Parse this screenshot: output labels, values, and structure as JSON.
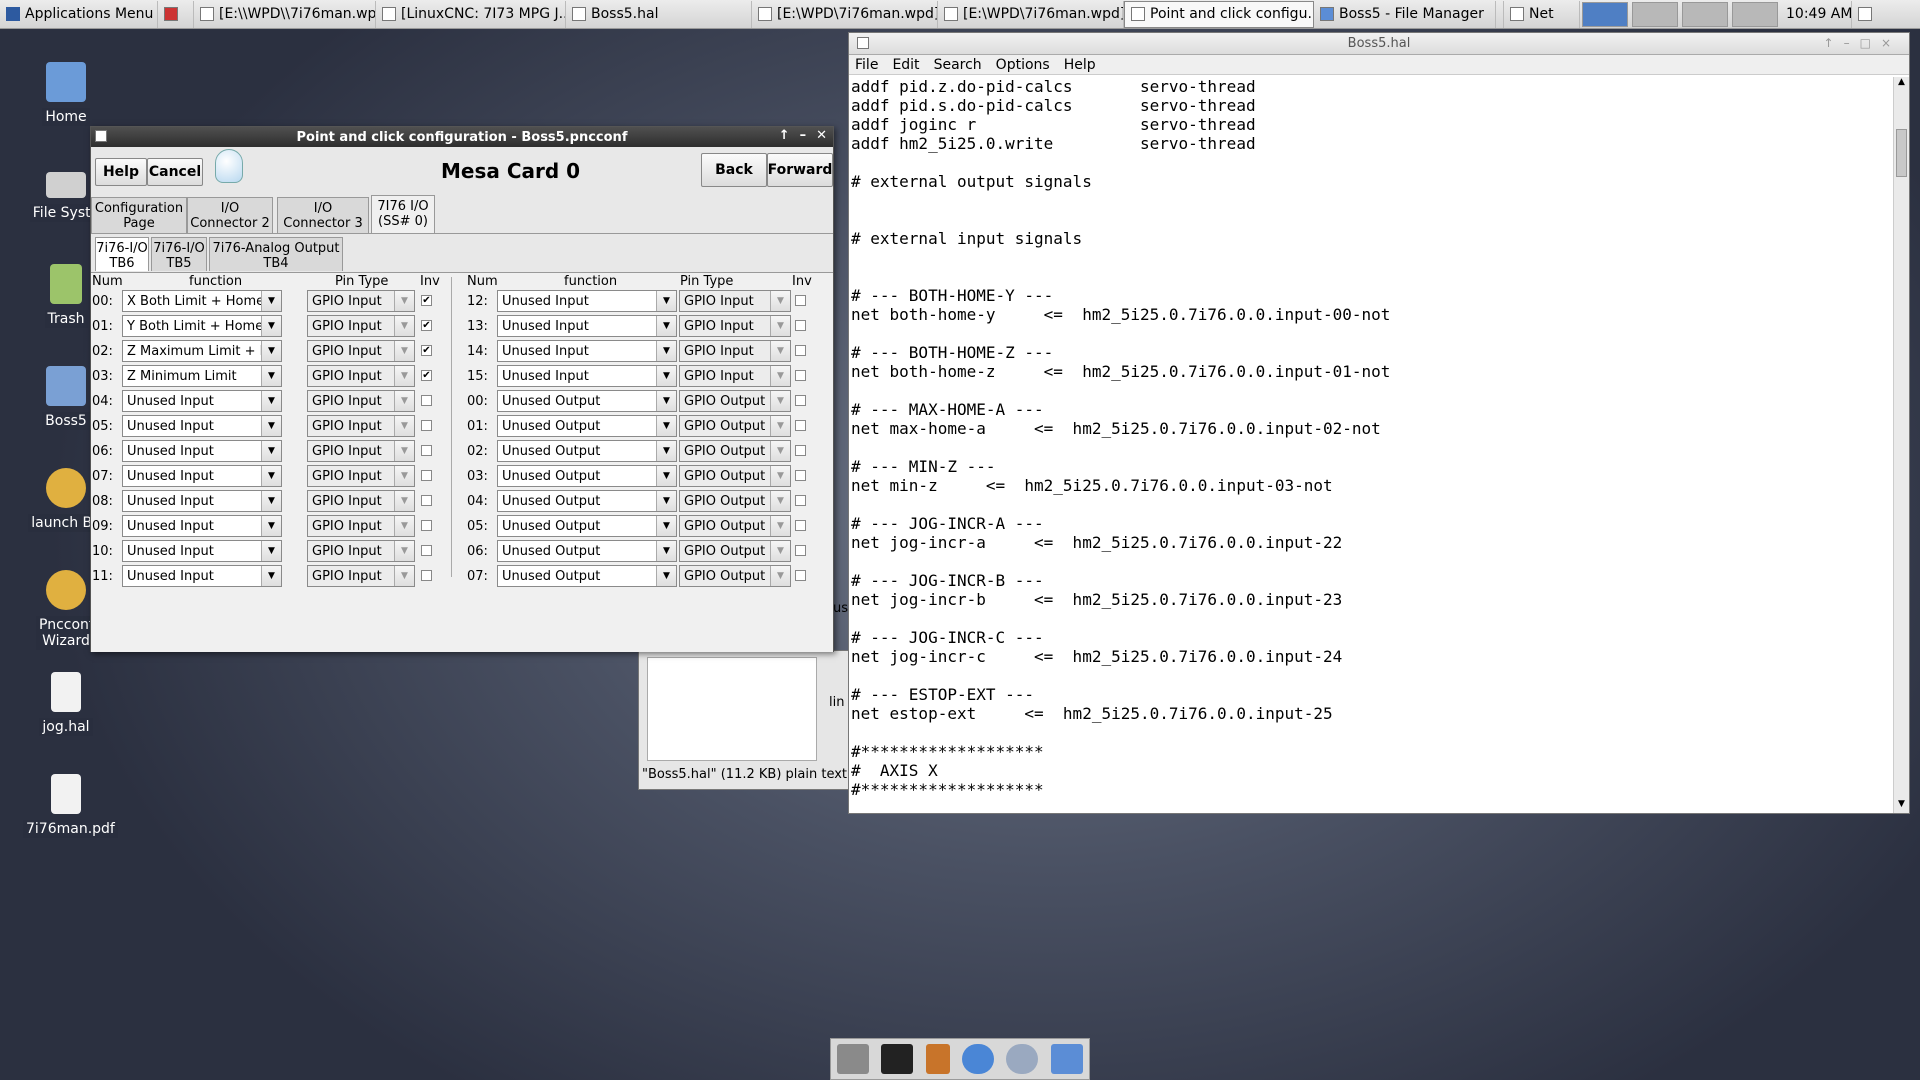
{
  "panel": {
    "apps_menu": "Applications Menu",
    "tasks": [
      {
        "label": "[E:\\\\WPD\\\\7i76man.wp..."
      },
      {
        "label": "[LinuxCNC: 7I73 MPG J..."
      },
      {
        "label": "Boss5.hal"
      },
      {
        "label": "[E:\\WPD\\7i76man.wpd]"
      },
      {
        "label": "[E:\\WPD\\7i76man.wpd]"
      },
      {
        "label": "Point and click configu..."
      },
      {
        "label": "Boss5 - File Manager"
      }
    ],
    "net": "Net",
    "clock": "10:49 AM"
  },
  "desktop": {
    "icons": [
      {
        "label": "Home"
      },
      {
        "label": "File Syste"
      },
      {
        "label": "Trash"
      },
      {
        "label": "Boss5"
      },
      {
        "label": "launch Bo"
      },
      {
        "label": "Pncconf Wizard"
      },
      {
        "label": "jog.hal"
      },
      {
        "label": "7i76man.pdf"
      }
    ]
  },
  "pncconf": {
    "title": "Point and click configuration - Boss5.pncconf",
    "help": "Help",
    "cancel": "Cancel",
    "back": "Back",
    "forward": "Forward",
    "heading": "Mesa Card 0",
    "tabs": [
      "Configuration\nPage",
      "I/O\nConnector 2",
      "I/O\nConnector 3",
      "7I76 I/O\n(SS# 0)"
    ],
    "subtabs": [
      "7i76-I/O\nTB6",
      "7i76-I/O\nTB5",
      "7i76-Analog Output\nTB4"
    ],
    "headers": {
      "num": "Num",
      "function": "function",
      "pintype": "Pin Type",
      "inv": "Inv"
    },
    "left_rows": [
      {
        "num": "00:",
        "fn": "X Both Limit + Home",
        "pt": "GPIO Input",
        "inv": true
      },
      {
        "num": "01:",
        "fn": "Y Both Limit + Home",
        "pt": "GPIO Input",
        "inv": true
      },
      {
        "num": "02:",
        "fn": "Z Maximum Limit + Ho",
        "pt": "GPIO Input",
        "inv": true
      },
      {
        "num": "03:",
        "fn": "Z Minimum Limit",
        "pt": "GPIO Input",
        "inv": true
      },
      {
        "num": "04:",
        "fn": "Unused Input",
        "pt": "GPIO Input",
        "inv": false
      },
      {
        "num": "05:",
        "fn": "Unused Input",
        "pt": "GPIO Input",
        "inv": false
      },
      {
        "num": "06:",
        "fn": "Unused Input",
        "pt": "GPIO Input",
        "inv": false
      },
      {
        "num": "07:",
        "fn": "Unused Input",
        "pt": "GPIO Input",
        "inv": false
      },
      {
        "num": "08:",
        "fn": "Unused Input",
        "pt": "GPIO Input",
        "inv": false
      },
      {
        "num": "09:",
        "fn": "Unused Input",
        "pt": "GPIO Input",
        "inv": false
      },
      {
        "num": "10:",
        "fn": "Unused Input",
        "pt": "GPIO Input",
        "inv": false
      },
      {
        "num": "11:",
        "fn": "Unused Input",
        "pt": "GPIO Input",
        "inv": false
      }
    ],
    "right_rows": [
      {
        "num": "12:",
        "fn": "Unused Input",
        "pt": "GPIO Input",
        "inv": false
      },
      {
        "num": "13:",
        "fn": "Unused Input",
        "pt": "GPIO Input",
        "inv": false
      },
      {
        "num": "14:",
        "fn": "Unused Input",
        "pt": "GPIO Input",
        "inv": false
      },
      {
        "num": "15:",
        "fn": "Unused Input",
        "pt": "GPIO Input",
        "inv": false
      },
      {
        "num": "00:",
        "fn": "Unused Output",
        "pt": "GPIO Output",
        "inv": false
      },
      {
        "num": "01:",
        "fn": "Unused Output",
        "pt": "GPIO Output",
        "inv": false
      },
      {
        "num": "02:",
        "fn": "Unused Output",
        "pt": "GPIO Output",
        "inv": false
      },
      {
        "num": "03:",
        "fn": "Unused Output",
        "pt": "GPIO Output",
        "inv": false
      },
      {
        "num": "04:",
        "fn": "Unused Output",
        "pt": "GPIO Output",
        "inv": false
      },
      {
        "num": "05:",
        "fn": "Unused Output",
        "pt": "GPIO Output",
        "inv": false
      },
      {
        "num": "06:",
        "fn": "Unused Output",
        "pt": "GPIO Output",
        "inv": false
      },
      {
        "num": "07:",
        "fn": "Unused Output",
        "pt": "GPIO Output",
        "inv": false
      }
    ]
  },
  "filemanager": {
    "status": "\"Boss5.hal\" (11.2 KB) plain text",
    "frag1": "us",
    "frag2": "lin"
  },
  "editor": {
    "title": "Boss5.hal",
    "menu": [
      "File",
      "Edit",
      "Search",
      "Options",
      "Help"
    ],
    "lines": [
      "addf pid.z.do-pid-calcs       servo-thread",
      "addf pid.s.do-pid-calcs       servo-thread",
      "addf joginc r                 servo-thread",
      "addf hm2_5i25.0.write         servo-thread",
      "",
      "# external output signals",
      "",
      "",
      "# external input signals",
      "",
      "",
      "# --- BOTH-HOME-Y ---",
      "net both-home-y     <=  hm2_5i25.0.7i76.0.0.input-00-not",
      "",
      "# --- BOTH-HOME-Z ---",
      "net both-home-z     <=  hm2_5i25.0.7i76.0.0.input-01-not",
      "",
      "# --- MAX-HOME-A ---",
      "net max-home-a     <=  hm2_5i25.0.7i76.0.0.input-02-not",
      "",
      "# --- MIN-Z ---",
      "net min-z     <=  hm2_5i25.0.7i76.0.0.input-03-not",
      "",
      "# --- JOG-INCR-A ---",
      "net jog-incr-a     <=  hm2_5i25.0.7i76.0.0.input-22",
      "",
      "# --- JOG-INCR-B ---",
      "net jog-incr-b     <=  hm2_5i25.0.7i76.0.0.input-23",
      "",
      "# --- JOG-INCR-C ---",
      "net jog-incr-c     <=  hm2_5i25.0.7i76.0.0.input-24",
      "",
      "# --- ESTOP-EXT ---",
      "net estop-ext     <=  hm2_5i25.0.7i76.0.0.input-25",
      "",
      "#*******************",
      "#  AXIS X",
      "#*******************"
    ]
  },
  "colors": {
    "titlebar": "#3a3a3a",
    "desktop": "#4a5163",
    "active_ws": "#4f7fc4"
  }
}
